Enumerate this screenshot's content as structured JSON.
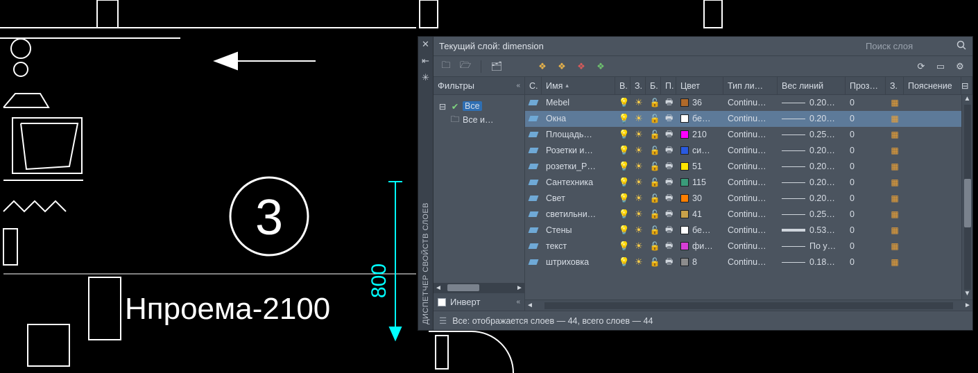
{
  "cad": {
    "bubble_number": "3",
    "text_label": "Нпроема-2100",
    "dim_value": "800"
  },
  "panel": {
    "rail_label": "ДИСПЕТЧЕР СВОЙСТВ СЛОЕВ",
    "title": "Текущий слой: dimension",
    "search_placeholder": "Поиск слоя",
    "filters_header": "Фильтры",
    "tree_root": "Все",
    "tree_child": "Все и…",
    "invert_label": "Инверт",
    "columns": {
      "status": "С.",
      "name": "Имя",
      "on": "В.",
      "freeze": "З.",
      "lock": "Б.",
      "plot": "П.",
      "color": "Цвет",
      "linetype": "Тип ли…",
      "lineweight": "Вес линий",
      "transp": "Проз…",
      "style": "З.",
      "desc": "Пояснение"
    },
    "layers": [
      {
        "name": "Mebel",
        "color_hex": "#b06a2a",
        "color_label": "36",
        "lt": "Continu…",
        "lw": "0.20…",
        "lw_class": "",
        "tr": "0"
      },
      {
        "name": "Окна",
        "color_hex": "#ffffff",
        "color_label": "бе…",
        "lt": "Continu…",
        "lw": "0.20…",
        "lw_class": "",
        "tr": "0",
        "selected": true
      },
      {
        "name": "Площадь…",
        "color_hex": "#ff00ff",
        "color_label": "210",
        "lt": "Continu…",
        "lw": "0.25…",
        "lw_class": "",
        "tr": "0"
      },
      {
        "name": "Розетки и…",
        "color_hex": "#2a5adf",
        "color_label": "си…",
        "lt": "Continu…",
        "lw": "0.20…",
        "lw_class": "",
        "tr": "0"
      },
      {
        "name": "розетки_Р…",
        "color_hex": "#ffe600",
        "color_label": "51",
        "lt": "Continu…",
        "lw": "0.20…",
        "lw_class": "",
        "tr": "0"
      },
      {
        "name": "Сантехника",
        "color_hex": "#3a9c7a",
        "color_label": "115",
        "lt": "Continu…",
        "lw": "0.20…",
        "lw_class": "",
        "tr": "0"
      },
      {
        "name": "Свет",
        "color_hex": "#ff7f00",
        "color_label": "30",
        "lt": "Continu…",
        "lw": "0.20…",
        "lw_class": "",
        "tr": "0"
      },
      {
        "name": "светильни…",
        "color_hex": "#c9a24a",
        "color_label": "41",
        "lt": "Continu…",
        "lw": "0.25…",
        "lw_class": "",
        "tr": "0"
      },
      {
        "name": "Стены",
        "color_hex": "#ffffff",
        "color_label": "бе…",
        "lt": "Continu…",
        "lw": "0.53…",
        "lw_class": "thk",
        "tr": "0"
      },
      {
        "name": "текст",
        "color_hex": "#d63ed6",
        "color_label": "фи…",
        "lt": "Continu…",
        "lw": "По у…",
        "lw_class": "",
        "tr": "0"
      },
      {
        "name": "штриховка",
        "color_hex": "#8c8c8c",
        "color_label": "8",
        "lt": "Continu…",
        "lw": "0.18…",
        "lw_class": "",
        "tr": "0"
      }
    ],
    "footer": "Все: отображается слоев — 44, всего слоев — 44"
  }
}
